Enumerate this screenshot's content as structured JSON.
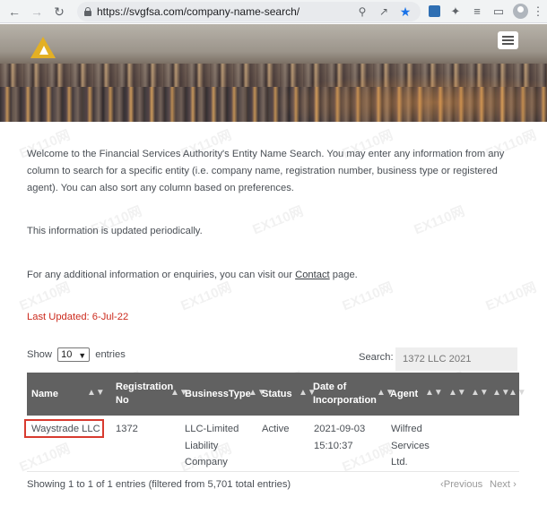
{
  "browser": {
    "url": "https://svgfsa.com/company-name-search/",
    "back_icon": "arrow-left-icon",
    "forward_icon": "arrow-right-icon",
    "reload_icon": "reload-icon"
  },
  "site": {
    "logo_icon": "fsa-triangle-logo",
    "menu_icon": "hamburger-menu-icon"
  },
  "content": {
    "intro": "Welcome to the Financial Services Authority's Entity Name Search. You may enter any information from any column to search for a specific entity (i.e. company name, registration number, business type or registered agent). You can also sort any column based on preferences.",
    "updated_note": "This information is updated periodically.",
    "contact_prefix": "For any additional information or enquiries, you can visit our",
    "contact_link": "Contact",
    "contact_suffix": "page.",
    "last_updated": "Last Updated:  6-Jul-22"
  },
  "table_controls": {
    "show_label": "Show",
    "page_size": "10",
    "entries_label": "entries",
    "search_label": "Search:",
    "search_value": "1372 LLC 2021"
  },
  "table": {
    "columns": [
      "Name",
      "Registration No",
      "BusinessType",
      "Status",
      "Date of Incorporation",
      "Agent"
    ],
    "rows": [
      {
        "name": "Waystrade LLC",
        "registration_no": "1372",
        "business_type": "LLC-Limited Liability Company",
        "status": "Active",
        "date": "2021-09-03 15:10:37",
        "agent": "Wilfred Services Ltd."
      }
    ]
  },
  "footer": {
    "info": "Showing 1 to 1 of 1 entries (filtered from 5,701 total entries)",
    "previous": "Previous",
    "next": "Next"
  },
  "colors": {
    "header_bg": "#616161",
    "last_updated": "#cc2b1e",
    "highlight_border": "#d83a2f",
    "logo": "#e3b024"
  }
}
